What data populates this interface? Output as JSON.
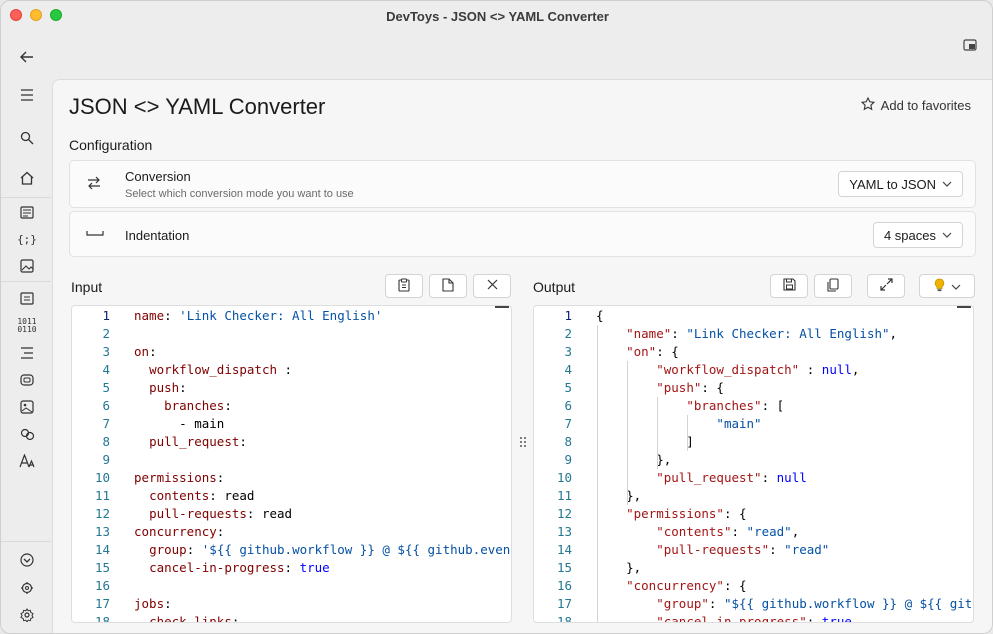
{
  "window": {
    "title": "DevToys - JSON <> YAML Converter"
  },
  "sidebar": {
    "items": [
      {
        "icon": "back-arrow-icon",
        "glyph": "←"
      },
      {
        "icon": "hamburger-menu-icon",
        "glyph": "☰"
      },
      {
        "icon": "search-icon",
        "glyph": "⌕"
      },
      {
        "icon": "home-icon",
        "glyph": "⌂"
      },
      {
        "icon": "converters-icon",
        "glyph": "▤"
      },
      {
        "icon": "json-formatter-icon",
        "glyph": "{;}"
      },
      {
        "icon": "image-converter-icon",
        "glyph": "▧"
      },
      {
        "icon": "encoders-icon",
        "glyph": "▣"
      },
      {
        "icon": "binary-icon",
        "glyph": "1011"
      },
      {
        "icon": "text-icon",
        "glyph": "≡"
      },
      {
        "icon": "graphics-icon",
        "glyph": "◎"
      },
      {
        "icon": "image-icon",
        "glyph": "▨"
      },
      {
        "icon": "link-icon",
        "glyph": "⊗"
      },
      {
        "icon": "font-icon",
        "glyph": "A"
      },
      {
        "icon": "extensions-icon",
        "glyph": "◉"
      },
      {
        "icon": "settings-gear-alt-icon",
        "glyph": "✿"
      },
      {
        "icon": "settings-icon",
        "glyph": "⚙"
      }
    ]
  },
  "header": {
    "page_title": "JSON <> YAML Converter",
    "favorite_label": "Add to favorites"
  },
  "configuration": {
    "label": "Configuration",
    "conversion": {
      "title": "Conversion",
      "description": "Select which conversion mode you want to use",
      "selected": "YAML to JSON"
    },
    "indentation": {
      "title": "Indentation",
      "selected": "4 spaces"
    }
  },
  "input": {
    "label": "Input",
    "lines": [
      {
        "n": "1",
        "t": "name: 'Link Checker: All English'"
      },
      {
        "n": "2",
        "t": ""
      },
      {
        "n": "3",
        "t": "on:"
      },
      {
        "n": "4",
        "t": "  workflow_dispatch :"
      },
      {
        "n": "5",
        "t": "  push:"
      },
      {
        "n": "6",
        "t": "    branches:"
      },
      {
        "n": "7",
        "t": "      - main"
      },
      {
        "n": "8",
        "t": "  pull_request:"
      },
      {
        "n": "9",
        "t": ""
      },
      {
        "n": "10",
        "t": "permissions:"
      },
      {
        "n": "11",
        "t": "  contents: read"
      },
      {
        "n": "12",
        "t": "  pull-requests: read"
      },
      {
        "n": "13",
        "t": "concurrency:"
      },
      {
        "n": "14",
        "t": "  group: '${{ github.workflow }} @ ${{ github.event.pu"
      },
      {
        "n": "15",
        "t": "  cancel-in-progress: true"
      },
      {
        "n": "16",
        "t": ""
      },
      {
        "n": "17",
        "t": "jobs:"
      },
      {
        "n": "18",
        "t": "  check-links:"
      }
    ]
  },
  "output": {
    "label": "Output",
    "lines": [
      {
        "n": "1",
        "t": "{"
      },
      {
        "n": "2",
        "t": "    \"name\": \"Link Checker: All English\","
      },
      {
        "n": "3",
        "t": "    \"on\": {"
      },
      {
        "n": "4",
        "t": "        \"workflow_dispatch\" : null,"
      },
      {
        "n": "5",
        "t": "        \"push\": {"
      },
      {
        "n": "6",
        "t": "            \"branches\": ["
      },
      {
        "n": "7",
        "t": "                \"main\""
      },
      {
        "n": "8",
        "t": "            ]"
      },
      {
        "n": "9",
        "t": "        },"
      },
      {
        "n": "10",
        "t": "        \"pull_request\": null"
      },
      {
        "n": "11",
        "t": "    },"
      },
      {
        "n": "12",
        "t": "    \"permissions\": {"
      },
      {
        "n": "13",
        "t": "        \"contents\": \"read\","
      },
      {
        "n": "14",
        "t": "        \"pull-requests\": \"read\""
      },
      {
        "n": "15",
        "t": "    },"
      },
      {
        "n": "16",
        "t": "    \"concurrency\": {"
      },
      {
        "n": "17",
        "t": "        \"group\": \"${{ github.workflow }} @ ${{ github"
      },
      {
        "n": "18",
        "t": "        \"cancel-in-progress\": true"
      }
    ]
  },
  "colors": {
    "accent": "#0b216f",
    "yaml_key": "#800000",
    "json_key": "#a31515",
    "string": "#0451a5"
  }
}
